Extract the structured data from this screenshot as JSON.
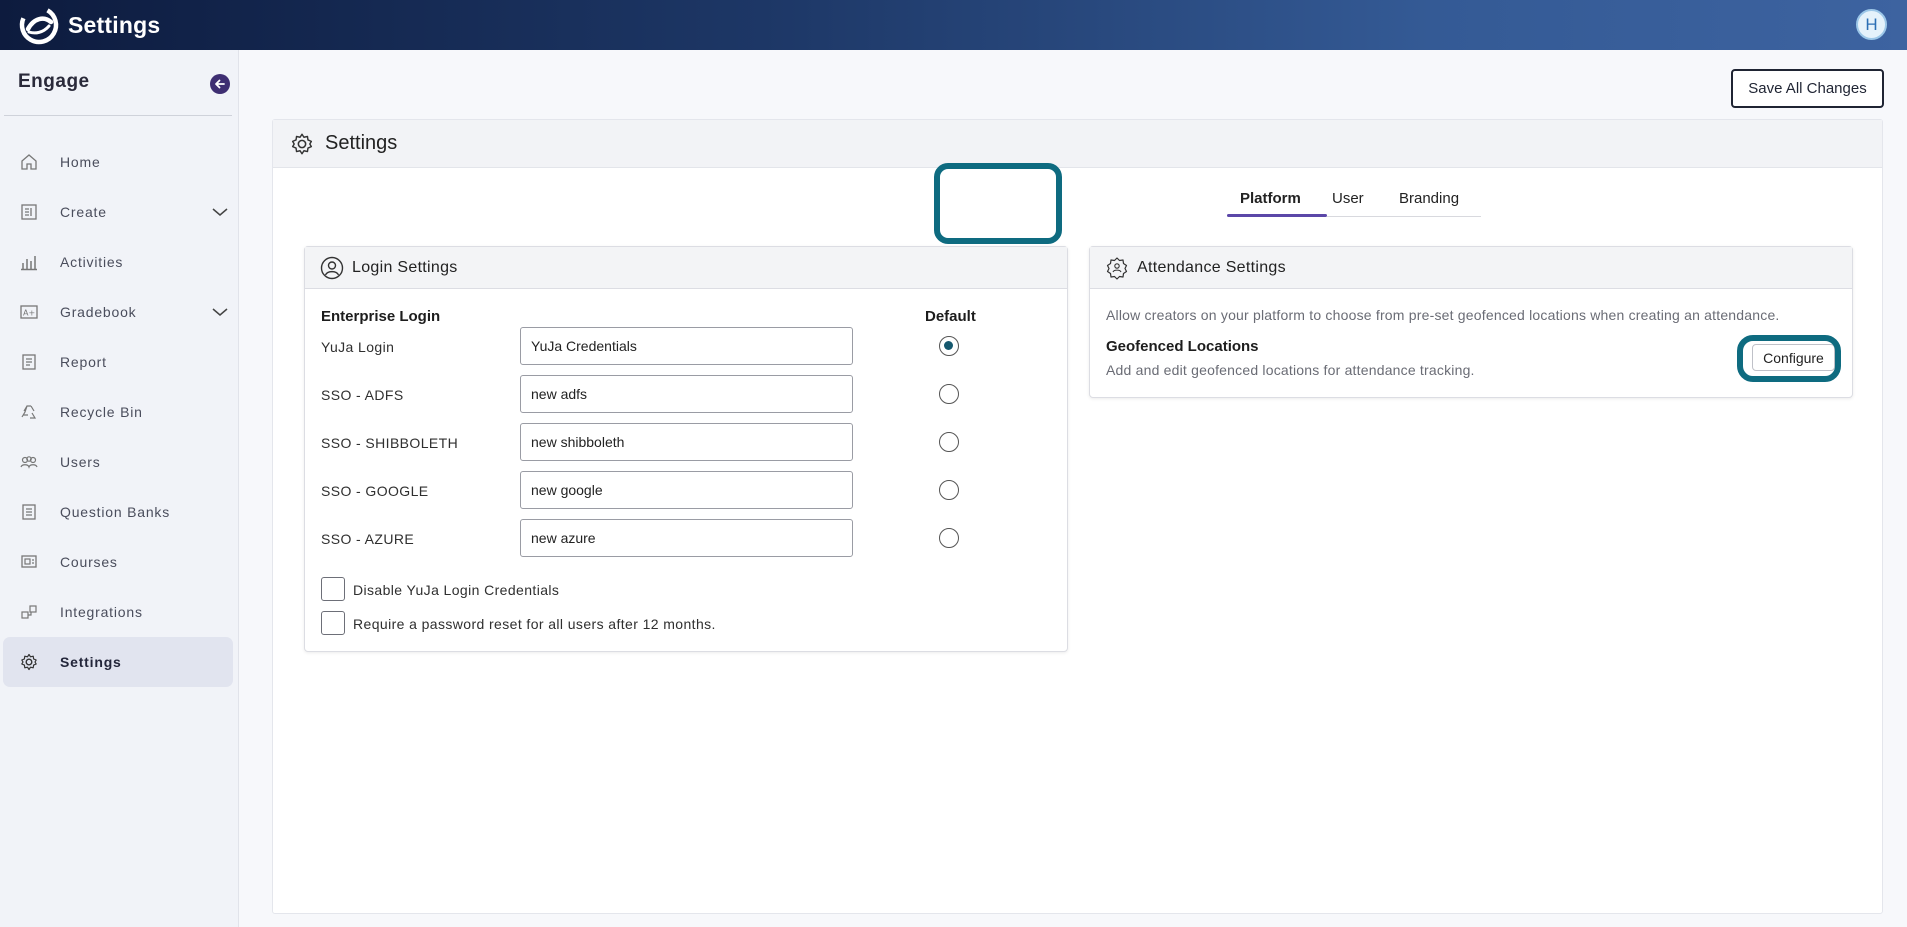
{
  "app": {
    "title": "Settings",
    "user_initial": "H"
  },
  "sidebar": {
    "title": "Engage",
    "items": [
      {
        "label": "Home",
        "icon": "home-icon",
        "expandable": false
      },
      {
        "label": "Create",
        "icon": "create-icon",
        "expandable": true
      },
      {
        "label": "Activities",
        "icon": "bar-chart-icon",
        "expandable": false
      },
      {
        "label": "Gradebook",
        "icon": "gradebook-icon",
        "expandable": true
      },
      {
        "label": "Report",
        "icon": "report-icon",
        "expandable": false
      },
      {
        "label": "Recycle Bin",
        "icon": "recycle-icon",
        "expandable": false
      },
      {
        "label": "Users",
        "icon": "users-icon",
        "expandable": false
      },
      {
        "label": "Question Banks",
        "icon": "question-bank-icon",
        "expandable": false
      },
      {
        "label": "Courses",
        "icon": "courses-icon",
        "expandable": false
      },
      {
        "label": "Integrations",
        "icon": "integrations-icon",
        "expandable": false
      },
      {
        "label": "Settings",
        "icon": "gear-icon",
        "expandable": false,
        "active": true
      }
    ]
  },
  "toolbar": {
    "save_label": "Save All Changes"
  },
  "panel": {
    "title": "Settings"
  },
  "tabs": [
    {
      "label": "Platform",
      "active": true
    },
    {
      "label": "User",
      "active": false
    },
    {
      "label": "Branding",
      "active": false
    }
  ],
  "login_settings": {
    "title": "Login Settings",
    "col_login": "Enterprise Login",
    "col_default": "Default",
    "rows": [
      {
        "label": "YuJa Login",
        "value": "YuJa Credentials",
        "default": true
      },
      {
        "label": "SSO - ADFS",
        "value": "new adfs",
        "default": false
      },
      {
        "label": "SSO - SHIBBOLETH",
        "value": "new shibboleth",
        "default": false
      },
      {
        "label": "SSO - GOOGLE",
        "value": "new google",
        "default": false
      },
      {
        "label": "SSO - AZURE",
        "value": "new azure",
        "default": false
      }
    ],
    "checkboxes": [
      {
        "label": "Disable YuJa Login Credentials",
        "checked": false
      },
      {
        "label": "Require a password reset for all users after 12 months.",
        "checked": false
      }
    ]
  },
  "attendance_settings": {
    "title": "Attendance Settings",
    "description": "Allow creators on your platform to choose from pre-set geofenced locations when creating an attendance.",
    "geo_title": "Geofenced Locations",
    "geo_description": "Add and edit geofenced locations for attendance tracking.",
    "configure_label": "Configure"
  },
  "colors": {
    "accent": "#5b47a8",
    "highlight": "#0e6b80",
    "radio_fill": "#15586e"
  }
}
